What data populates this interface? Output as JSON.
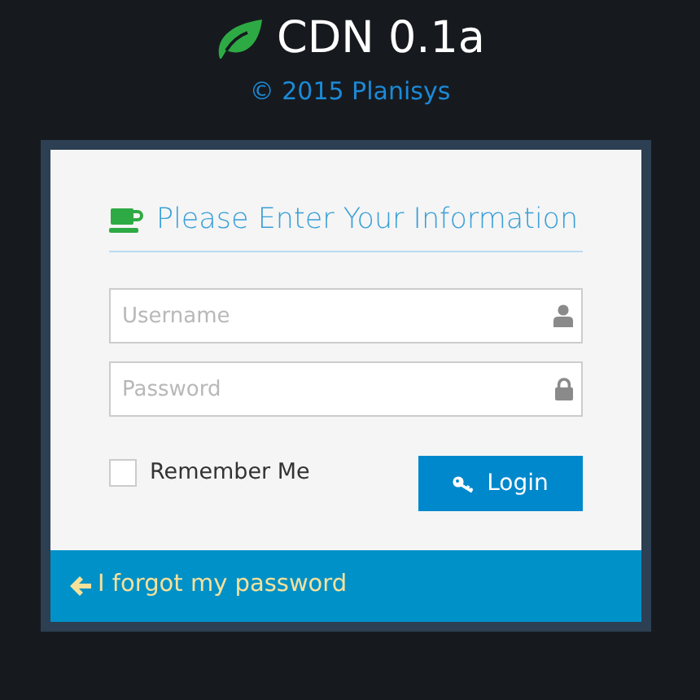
{
  "brand": {
    "title": "CDN 0.1a",
    "copyright": "© 2015 Planisys"
  },
  "form": {
    "heading": "Please Enter Your Information",
    "fields": [
      {
        "kind": "user",
        "placeholder": "Username"
      },
      {
        "kind": "lock",
        "placeholder": "Password"
      }
    ],
    "remember": {
      "label": "Remember Me",
      "checked": false
    },
    "login_button": "Login"
  },
  "footer_link": "I forgot my password"
}
